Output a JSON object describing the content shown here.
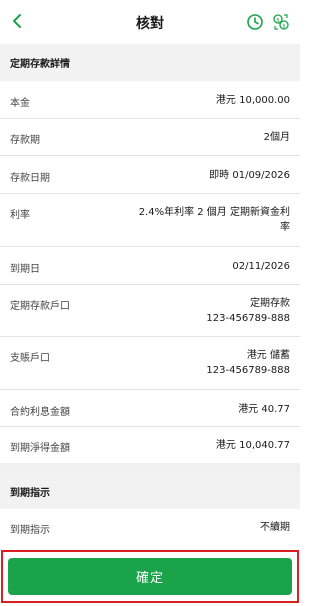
{
  "header": {
    "title": "核對",
    "back_icon": "chevron-left-icon",
    "clock_icon": "clock-icon",
    "fx_icon": "currency-exchange-icon",
    "accent": "#1aa34a"
  },
  "details_section": {
    "title": "定期存款詳情",
    "rows": [
      {
        "label": "本金",
        "value": "港元 10,000.00"
      },
      {
        "label": "存款期",
        "value": "2個月"
      },
      {
        "label": "存款日期",
        "value": "即時 01/09/2026"
      },
      {
        "label": "利率",
        "value_line1": "2.4%年利率 2 個月 定期新資金利",
        "value_line2": "率"
      },
      {
        "label": "到期日",
        "value": "02/11/2026"
      },
      {
        "label": "定期存款戶口",
        "value_line1": "定期存款",
        "value_line2": "123-456789-888"
      },
      {
        "label": "支賬戶口",
        "value_line1": "港元 儲蓄",
        "value_line2": "123-456789-888"
      },
      {
        "label": "合約利息金額",
        "value": "港元 40.77"
      },
      {
        "label": "到期淨得金額",
        "value": "港元 10,040.77"
      }
    ]
  },
  "maturity_section": {
    "title": "到期指示",
    "row": {
      "label": "到期指示",
      "value": "不續期"
    }
  },
  "footer": {
    "confirm_label": "確定",
    "button_color": "#1aa34a",
    "highlight_color": "#d81e1e"
  }
}
